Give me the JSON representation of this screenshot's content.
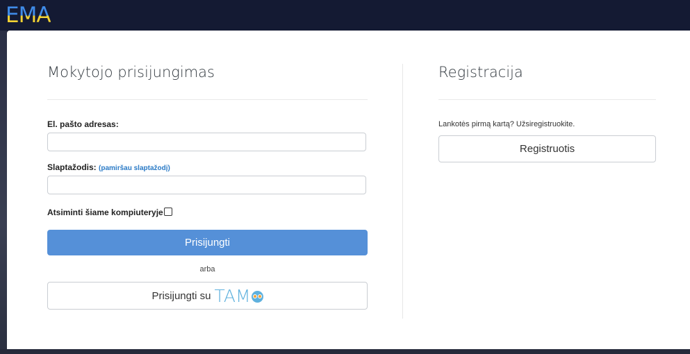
{
  "header": {
    "logo_text": "EMA"
  },
  "login": {
    "title": "Mokytojo prisijungimas",
    "email_label": "El. pašto adresas:",
    "email_value": "",
    "password_label": "Slaptažodis:",
    "forgot_link": "(pamiršau slaptažodį)",
    "password_value": "",
    "remember_label": "Atsiminti šiame kompiuteryje",
    "remember_checked": false,
    "submit_label": "Prisijungti",
    "or_text": "arba",
    "tamo_button_label": "Prisijungti su",
    "tamo_logo_text": "TAM"
  },
  "register": {
    "title": "Registracija",
    "prompt": "Lankotės pirmą kartą? Užsiregistruokite.",
    "button_label": "Registruotis"
  },
  "colors": {
    "topbar": "#141a33",
    "primary_button": "#5590d8",
    "link": "#2a7ac6",
    "tamo": "#5fb1de",
    "logo_blue": "#3f8be8",
    "logo_yellow": "#f2d233"
  }
}
